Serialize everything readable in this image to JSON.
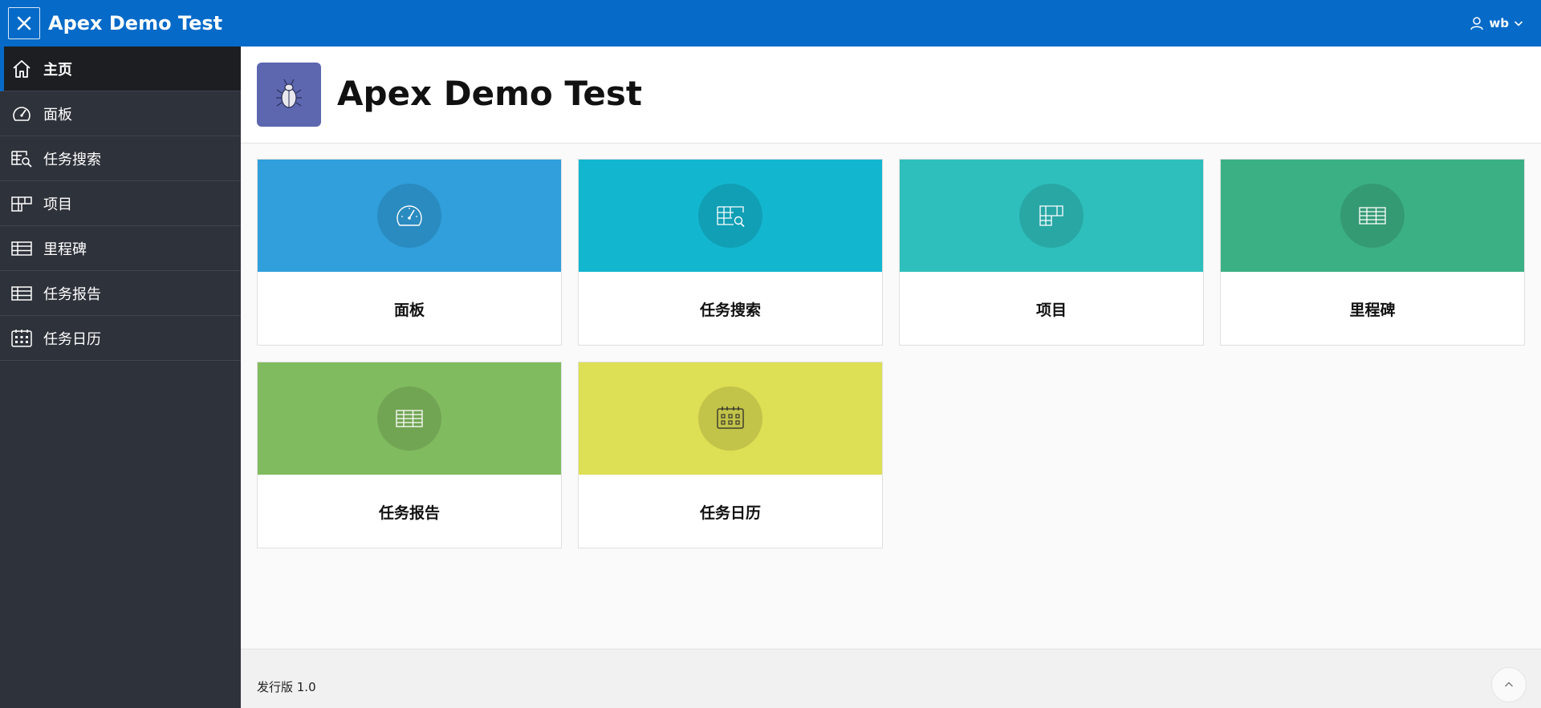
{
  "header": {
    "app_title": "Apex Demo Test",
    "menu_icon": "close-icon",
    "user_name": "wb",
    "user_icon": "user-icon",
    "dropdown_icon": "chevron-down-icon",
    "background": "#056ac8"
  },
  "sidebar": {
    "items": [
      {
        "label": "主页",
        "icon": "home-icon",
        "active": true
      },
      {
        "label": "面板",
        "icon": "gauge-icon",
        "active": false
      },
      {
        "label": "任务搜索",
        "icon": "table-search-icon",
        "active": false
      },
      {
        "label": "项目",
        "icon": "grid-icon",
        "active": false
      },
      {
        "label": "里程碑",
        "icon": "table-icon",
        "active": false
      },
      {
        "label": "任务报告",
        "icon": "table-icon",
        "active": false
      },
      {
        "label": "任务日历",
        "icon": "calendar-icon",
        "active": false
      }
    ]
  },
  "hero": {
    "title": "Apex Demo Test",
    "icon": "bug-icon",
    "icon_color": "#5c67b0"
  },
  "cards": [
    {
      "label": "面板",
      "icon": "gauge-icon",
      "color": "#309fdb"
    },
    {
      "label": "任务搜索",
      "icon": "table-search-icon",
      "color": "#13b6cf"
    },
    {
      "label": "项目",
      "icon": "grid-icon",
      "color": "#2ebfbc"
    },
    {
      "label": "里程碑",
      "icon": "table-icon",
      "color": "#3cb085"
    },
    {
      "label": "任务报告",
      "icon": "table-icon",
      "color": "#81bb5f"
    },
    {
      "label": "任务日历",
      "icon": "calendar-icon",
      "color": "#dddf54"
    }
  ],
  "footer": {
    "release": "发行版 1.0",
    "scroll_top_icon": "chevron-up-icon"
  }
}
